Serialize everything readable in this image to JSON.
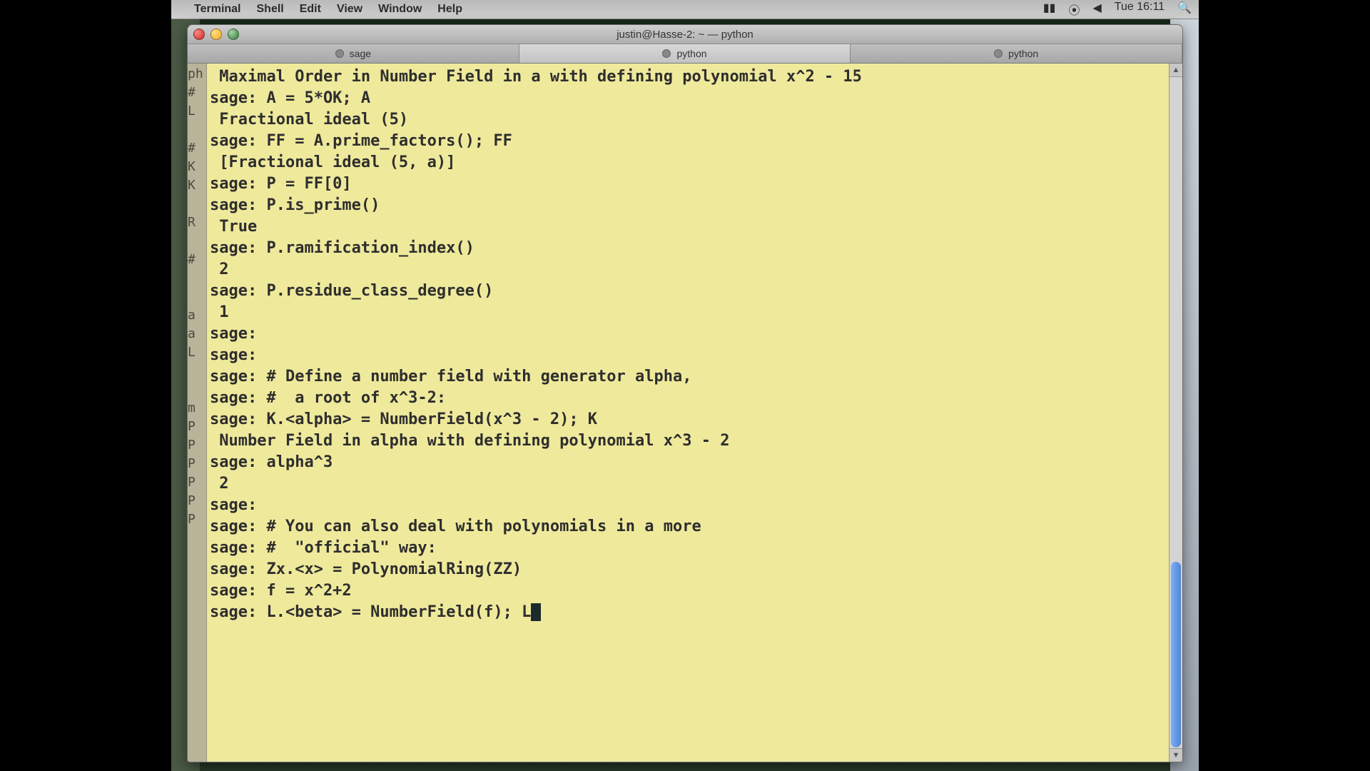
{
  "menubar": {
    "app": "Terminal",
    "items": [
      "Shell",
      "Edit",
      "View",
      "Window",
      "Help"
    ],
    "right": {
      "batt": "",
      "wifi": "",
      "vol": "",
      "clock": "Tue 16:11"
    }
  },
  "window": {
    "title": "justin@Hasse-2: ~ — python",
    "tabs": [
      {
        "label": "sage",
        "active": false
      },
      {
        "label": "python",
        "active": true
      },
      {
        "label": "python",
        "active": false
      }
    ]
  },
  "gutter_text": "ph\n#\nL\n \n#\nK\nK\n \nR\n \n#\n \n \na\na\nL\n \n \nm\nP\nP\nP\nP\nP\nP\n ",
  "terminal": {
    "lines": [
      " Maximal Order in Number Field in a with defining polynomial x^2 - 15",
      "sage: A = 5*OK; A",
      " Fractional ideal (5)",
      "sage: FF = A.prime_factors(); FF",
      " [Fractional ideal (5, a)]",
      "sage: P = FF[0]",
      "sage: P.is_prime()",
      " True",
      "sage: P.ramification_index()",
      " 2",
      "sage: P.residue_class_degree()",
      " 1",
      "sage:",
      "sage:",
      "sage: # Define a number field with generator alpha,",
      "sage: #  a root of x^3-2:",
      "sage: K.<alpha> = NumberField(x^3 - 2); K",
      " Number Field in alpha with defining polynomial x^3 - 2",
      "sage: alpha^3",
      " 2",
      "sage:",
      "sage: # You can also deal with polynomials in a more",
      "sage: #  \"official\" way:",
      "sage: Zx.<x> = PolynomialRing(ZZ)",
      "sage: f = x^2+2",
      "sage: L.<beta> = NumberField(f); L"
    ],
    "cursor_after_last": true
  }
}
